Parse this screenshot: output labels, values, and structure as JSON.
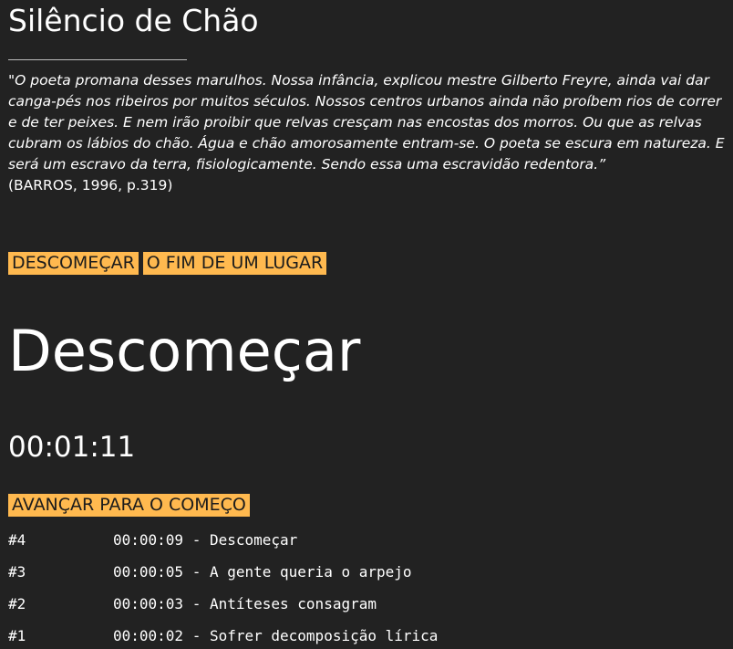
{
  "header": {
    "title": "Silêncio de Chão"
  },
  "epigraph": {
    "quote": "\"O poeta promana desses marulhos. Nossa infância, explicou mestre Gilberto Freyre, ainda vai dar canga-pés nos ribeiros por muitos séculos. Nossos centros urbanos ainda não proíbem rios de correr e de ter peixes. E nem irão proibir que relvas cresçam nas encostas dos morros. Ou que as relvas cubram os lábios do chão. Água e chão amorosamente entram-se. O poeta se escura em natureza. E será um escravo da terra, fisiologicamente. Sendo essa uma escravidão redentora.”",
    "citation": "(BARROS, 1996, p.319)"
  },
  "nav": {
    "descomecar_label": "DESCOMEÇAR",
    "fim_label": "O FIM DE UM LUGAR"
  },
  "main": {
    "heading": "Descomeçar",
    "timer": "00:01:11",
    "advance_label": "AVANÇAR PARA O COMEÇO"
  },
  "history": [
    {
      "num": "#4",
      "entry": "00:00:09 - Descomeçar"
    },
    {
      "num": "#3",
      "entry": "00:00:05 - A gente queria o arpejo"
    },
    {
      "num": "#2",
      "entry": "00:00:03 - Antíteses consagram"
    },
    {
      "num": "#1",
      "entry": "00:00:02 - Sofrer decomposição lírica"
    }
  ],
  "colors": {
    "background": "#222222",
    "accent": "#ffb94f",
    "text": "#ffffff"
  }
}
